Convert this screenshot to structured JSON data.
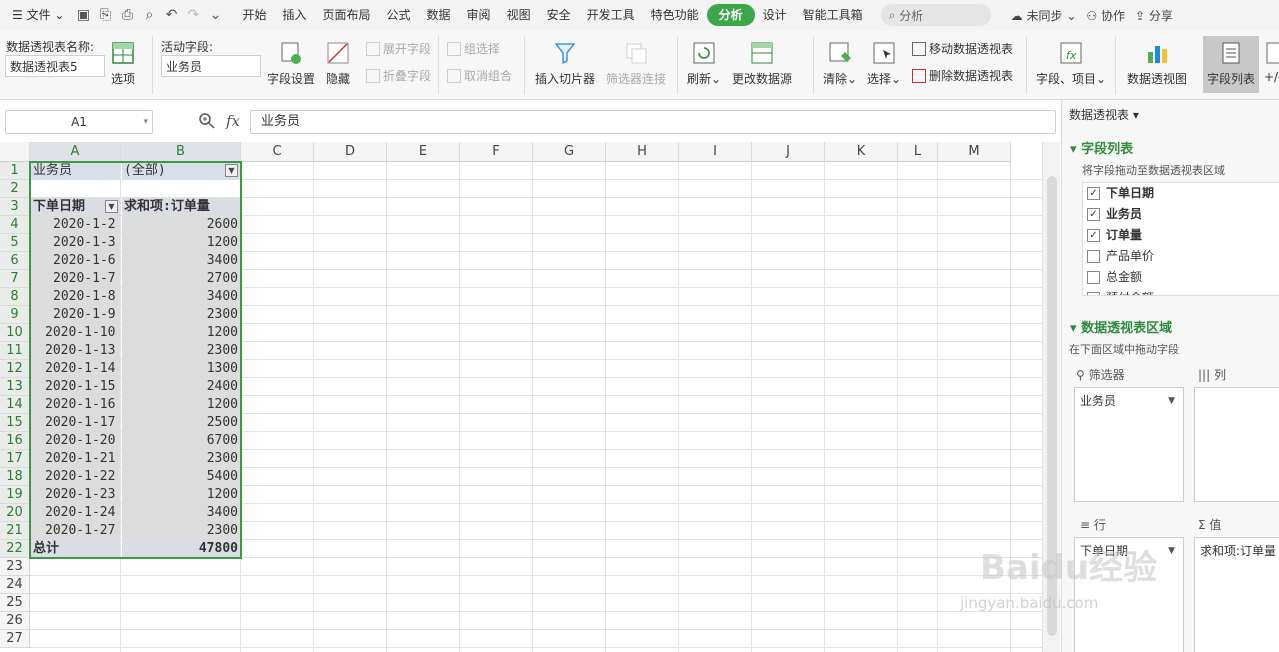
{
  "menu": {
    "file": "文件",
    "tabs": [
      "开始",
      "插入",
      "页面布局",
      "公式",
      "数据",
      "审阅",
      "视图",
      "安全",
      "开发工具",
      "特色功能",
      "分析",
      "设计",
      "智能工具箱"
    ],
    "active_tab": "分析",
    "search_placeholder": "分析",
    "sync": "未同步",
    "collab": "协作",
    "share": "分享"
  },
  "ribbon": {
    "pivot_name_label": "数据透视表名称:",
    "pivot_name_value": "数据透视表5",
    "options": "选项",
    "active_field_label": "活动字段:",
    "active_field_value": "业务员",
    "field_settings": "字段设置",
    "hide": "隐藏",
    "expand_field": "展开字段",
    "collapse_field": "折叠字段",
    "group_selection": "组选择",
    "ungroup": "取消组合",
    "insert_slicer": "插入切片器",
    "filter_connection": "筛选器连接",
    "refresh": "刷新",
    "change_source": "更改数据源",
    "clear": "清除",
    "select": "选择",
    "move_pivot": "移动数据透视表",
    "delete_pivot": "删除数据透视表",
    "fields_items": "字段、项目",
    "pivot_chart": "数据透视图",
    "field_list": "字段列表",
    "plus_minus": "+/-"
  },
  "formula_bar": {
    "name_box": "A1",
    "fx": "fx",
    "content": "业务员"
  },
  "columns": [
    "A",
    "B",
    "C",
    "D",
    "E",
    "F",
    "G",
    "H",
    "I",
    "J",
    "K",
    "L",
    "M"
  ],
  "rows": [
    "1",
    "2",
    "3",
    "4",
    "5",
    "6",
    "7",
    "8",
    "9",
    "10",
    "11",
    "12",
    "13",
    "14",
    "15",
    "16",
    "17",
    "18",
    "19",
    "20",
    "21",
    "22",
    "23",
    "24",
    "25",
    "26",
    "27"
  ],
  "pivot": {
    "filter_label": "业务员",
    "filter_value": "(全部)",
    "row_header": "下单日期",
    "value_header": "求和项:订单量",
    "records": [
      {
        "date": "2020-1-2",
        "qty": "2600"
      },
      {
        "date": "2020-1-3",
        "qty": "1200"
      },
      {
        "date": "2020-1-6",
        "qty": "3400"
      },
      {
        "date": "2020-1-7",
        "qty": "2700"
      },
      {
        "date": "2020-1-8",
        "qty": "3400"
      },
      {
        "date": "2020-1-9",
        "qty": "2300"
      },
      {
        "date": "2020-1-10",
        "qty": "1200"
      },
      {
        "date": "2020-1-13",
        "qty": "2300"
      },
      {
        "date": "2020-1-14",
        "qty": "1300"
      },
      {
        "date": "2020-1-15",
        "qty": "2400"
      },
      {
        "date": "2020-1-16",
        "qty": "1200"
      },
      {
        "date": "2020-1-17",
        "qty": "2500"
      },
      {
        "date": "2020-1-20",
        "qty": "6700"
      },
      {
        "date": "2020-1-21",
        "qty": "2300"
      },
      {
        "date": "2020-1-22",
        "qty": "5400"
      },
      {
        "date": "2020-1-23",
        "qty": "1200"
      },
      {
        "date": "2020-1-24",
        "qty": "3400"
      },
      {
        "date": "2020-1-27",
        "qty": "2300"
      }
    ],
    "total_label": "总计",
    "total_value": "47800"
  },
  "pane": {
    "title": "数据透视表",
    "field_list_title": "字段列表",
    "field_list_hint": "将字段拖动至数据透视表区域",
    "fields": [
      {
        "name": "下单日期",
        "checked": true
      },
      {
        "name": "业务员",
        "checked": true
      },
      {
        "name": "订单量",
        "checked": true
      },
      {
        "name": "产品单价",
        "checked": false
      },
      {
        "name": "总金额",
        "checked": false
      },
      {
        "name": "预付金额",
        "checked": false
      }
    ],
    "area_title": "数据透视表区域",
    "area_hint": "在下面区域中拖动字段",
    "filters_label": "筛选器",
    "columns_label": "列",
    "rows_label": "行",
    "values_label": "值",
    "filter_item": "业务员",
    "row_item": "下单日期",
    "value_item": "求和项:订单量"
  },
  "watermark": {
    "logo": "Baidu经验",
    "url": "jingyan.baidu.com"
  }
}
